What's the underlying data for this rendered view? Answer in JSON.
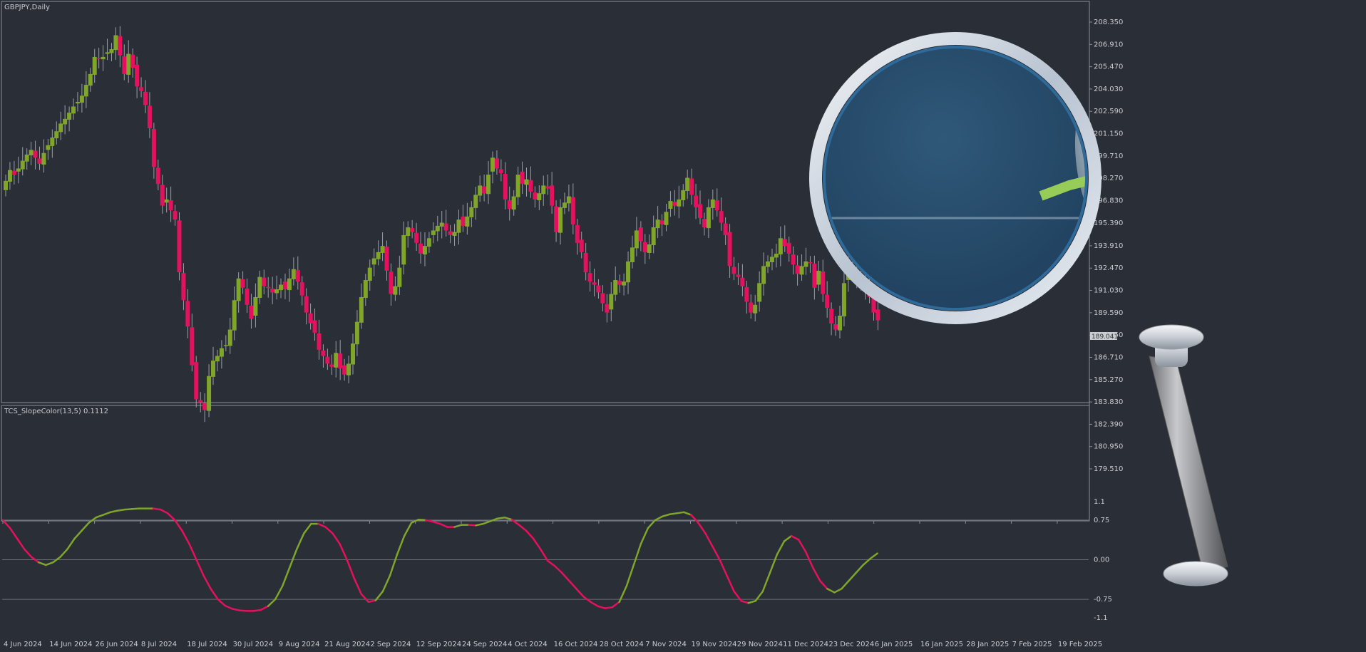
{
  "chart_window": {
    "title": "GBPJPY,Daily",
    "symbol": "GBPJPY",
    "timeframe": "Daily"
  },
  "indicator": {
    "label": "TCS_SlopeColor(13,5) 0.1112",
    "levels": [
      "1.1",
      "0.75",
      "0.00",
      "-0.75",
      "-1.1"
    ]
  },
  "colors": {
    "background": "#2a2e36",
    "bull": "#7fa52b",
    "bear": "#e5115e",
    "grid": "#6a6f78",
    "text": "#c9ccd1"
  },
  "chart_data": [
    {
      "type": "candlestick",
      "series": [
        {
          "name": "GBPJPY"
        }
      ],
      "y_ticks": [
        "208.350",
        "206.910",
        "205.470",
        "204.030",
        "202.590",
        "201.150",
        "199.710",
        "198.270",
        "196.830",
        "195.390",
        "193.910",
        "192.470",
        "191.030",
        "189.590",
        "188.150",
        "186.710",
        "185.270",
        "183.830",
        "182.390",
        "180.950",
        "179.510"
      ],
      "ylim": [
        179.51,
        208.35
      ],
      "current_price": "189.041",
      "x_ticks": [
        "4 Jun 2024",
        "14 Jun 2024",
        "26 Jun 2024",
        "8 Jul 2024",
        "18 Jul 2024",
        "30 Jul 2024",
        "9 Aug 2024",
        "21 Aug 2024",
        "2 Sep 2024",
        "12 Sep 2024",
        "24 Sep 2024",
        "4 Oct 2024",
        "16 Oct 2024",
        "28 Oct 2024",
        "7 Nov 2024",
        "19 Nov 2024",
        "29 Nov 2024",
        "11 Dec 2024",
        "23 Dec 2024",
        "6 Jan 2025",
        "16 Jan 2025",
        "28 Jan 2025",
        "7 Feb 2025",
        "19 Feb 2025"
      ],
      "close": [
        198.1,
        198.8,
        198.5,
        198.9,
        199.4,
        199.8,
        200.1,
        199.6,
        199.2,
        199.9,
        200.4,
        200.9,
        201.3,
        201.8,
        202.1,
        202.5,
        202.9,
        203.2,
        203.6,
        204.3,
        205.0,
        206.1,
        206.0,
        206.1,
        206.4,
        206.6,
        207.5,
        206.2,
        205.0,
        206.3,
        205.4,
        204.2,
        203.9,
        203.0,
        201.5,
        199.0,
        197.9,
        196.5,
        196.9,
        196.2,
        195.6,
        192.2,
        190.4,
        188.7,
        186.2,
        184.0,
        183.8,
        183.3,
        185.5,
        186.5,
        186.8,
        187.3,
        187.5,
        188.5,
        190.4,
        191.8,
        191.2,
        190.1,
        189.2,
        190.6,
        191.9,
        191.3,
        191.2,
        190.9,
        191.1,
        191.4,
        191.1,
        191.8,
        192.4,
        191.6,
        190.7,
        189.6,
        188.9,
        188.3,
        187.2,
        186.8,
        186.3,
        186.1,
        187.0,
        186.0,
        185.6,
        186.3,
        187.6,
        189.0,
        190.6,
        191.7,
        192.5,
        193.1,
        193.5,
        193.9,
        192.3,
        190.8,
        191.3,
        192.5,
        194.6,
        195.1,
        194.8,
        194.1,
        193.4,
        193.9,
        194.4,
        194.9,
        195.2,
        195.4,
        194.9,
        194.6,
        194.8,
        195.6,
        195.2,
        195.8,
        196.4,
        197.2,
        197.8,
        197.3,
        198.5,
        199.6,
        198.9,
        198.6,
        196.9,
        196.3,
        197.1,
        198.5,
        197.9,
        198.2,
        197.4,
        196.9,
        197.3,
        197.8,
        197.6,
        196.5,
        194.8,
        196.4,
        196.7,
        197.1,
        195.3,
        194.1,
        193.5,
        192.2,
        191.6,
        191.4,
        190.9,
        190.2,
        189.6,
        190.8,
        191.7,
        191.4,
        191.6,
        192.9,
        193.8,
        194.9,
        194.2,
        193.5,
        194.0,
        195.1,
        195.6,
        195.3,
        196.1,
        196.8,
        196.5,
        196.9,
        197.5,
        198.3,
        197.2,
        196.4,
        195.7,
        195.1,
        196.4,
        196.9,
        196.2,
        195.4,
        194.6,
        192.6,
        192.1,
        191.9,
        191.3,
        190.3,
        189.6,
        190.1,
        191.5,
        192.6,
        192.9,
        193.2,
        193.4,
        194.4,
        193.9,
        193.4,
        192.7,
        192.1,
        192.6,
        192.9,
        192.8,
        191.2,
        192.3,
        190.8,
        189.9,
        188.9,
        188.5,
        189.4,
        191.5,
        192.7,
        192.1,
        191.7,
        191.8,
        191.2,
        190.6,
        189.6,
        189.1
      ]
    },
    {
      "type": "line",
      "series": [
        {
          "name": "TCS_SlopeColor(13,5)"
        }
      ],
      "ylim": [
        -1.1,
        1.1
      ],
      "values": [
        0.75,
        0.6,
        0.4,
        0.2,
        0.05,
        -0.05,
        -0.1,
        -0.05,
        0.05,
        0.2,
        0.4,
        0.55,
        0.7,
        0.8,
        0.85,
        0.9,
        0.93,
        0.95,
        0.96,
        0.97,
        0.97,
        0.97,
        0.95,
        0.88,
        0.75,
        0.55,
        0.3,
        0.0,
        -0.3,
        -0.55,
        -0.75,
        -0.87,
        -0.93,
        -0.96,
        -0.97,
        -0.97,
        -0.95,
        -0.88,
        -0.75,
        -0.5,
        -0.15,
        0.2,
        0.5,
        0.68,
        0.68,
        0.62,
        0.5,
        0.3,
        0.0,
        -0.35,
        -0.65,
        -0.8,
        -0.77,
        -0.6,
        -0.3,
        0.1,
        0.45,
        0.7,
        0.76,
        0.75,
        0.72,
        0.68,
        0.62,
        0.62,
        0.66,
        0.66,
        0.65,
        0.68,
        0.73,
        0.78,
        0.8,
        0.76,
        0.66,
        0.55,
        0.4,
        0.2,
        -0.02,
        -0.12,
        -0.25,
        -0.4,
        -0.55,
        -0.7,
        -0.8,
        -0.88,
        -0.92,
        -0.9,
        -0.8,
        -0.5,
        -0.1,
        0.3,
        0.6,
        0.75,
        0.82,
        0.86,
        0.88,
        0.9,
        0.85,
        0.7,
        0.5,
        0.25,
        0.0,
        -0.3,
        -0.6,
        -0.78,
        -0.82,
        -0.78,
        -0.6,
        -0.25,
        0.1,
        0.35,
        0.45,
        0.38,
        0.15,
        -0.15,
        -0.4,
        -0.55,
        -0.62,
        -0.55,
        -0.4,
        -0.25,
        -0.1,
        0.02,
        0.12
      ],
      "colors": [
        "bear",
        "bear",
        "bear",
        "bear",
        "bear",
        "bull",
        "bull",
        "bull",
        "bull",
        "bull",
        "bull",
        "bull",
        "bull",
        "bull",
        "bull",
        "bull",
        "bull",
        "bull",
        "bull",
        "bull",
        "bull",
        "bear",
        "bear",
        "bear",
        "bear",
        "bear",
        "bear",
        "bear",
        "bear",
        "bear",
        "bear",
        "bear",
        "bear",
        "bear",
        "bear",
        "bear",
        "bear",
        "bull",
        "bull",
        "bull",
        "bull",
        "bull",
        "bull",
        "bull",
        "bear",
        "bear",
        "bear",
        "bear",
        "bear",
        "bear",
        "bear",
        "bear",
        "bull",
        "bull",
        "bull",
        "bull",
        "bull",
        "bull",
        "bull",
        "bear",
        "bear",
        "bear",
        "bear",
        "bull",
        "bull",
        "bear",
        "bull",
        "bull",
        "bull",
        "bull",
        "bull",
        "bear",
        "bear",
        "bear",
        "bear",
        "bear",
        "bear",
        "bear",
        "bear",
        "bear",
        "bear",
        "bear",
        "bear",
        "bear",
        "bear",
        "bear",
        "bull",
        "bull",
        "bull",
        "bull",
        "bull",
        "bull",
        "bull",
        "bull",
        "bull",
        "bull",
        "bear",
        "bear",
        "bear",
        "bear",
        "bear",
        "bear",
        "bear",
        "bear",
        "bull",
        "bull",
        "bull",
        "bull",
        "bull",
        "bull",
        "bear",
        "bear",
        "bear",
        "bear",
        "bear",
        "bull",
        "bull",
        "bull",
        "bull",
        "bull",
        "bull",
        "bull"
      ]
    }
  ],
  "magnifier": {
    "icon": "magnifying-glass-icon"
  }
}
